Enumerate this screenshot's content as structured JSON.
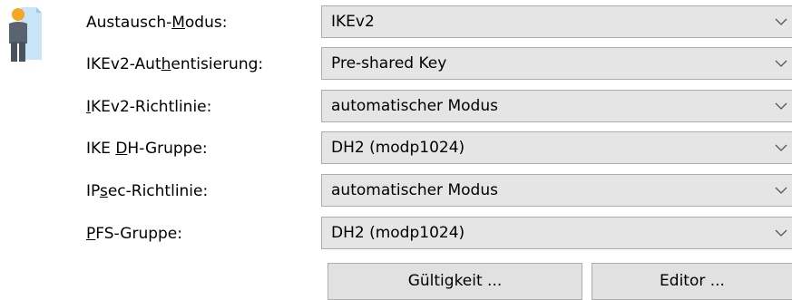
{
  "rows": [
    {
      "label_pre": "Austausch-",
      "label_key": "M",
      "label_post": "odus:",
      "value": "IKEv2"
    },
    {
      "label_pre": "IKEv2-Aut",
      "label_key": "h",
      "label_post": "entisierung:",
      "value": "Pre-shared Key"
    },
    {
      "label_pre": "",
      "label_key": "I",
      "label_post": "KEv2-Richtlinie:",
      "value": "automatischer Modus"
    },
    {
      "label_pre": "IKE ",
      "label_key": "D",
      "label_post": "H-Gruppe:",
      "value": "DH2 (modp1024)"
    },
    {
      "label_pre": "IP",
      "label_key": "s",
      "label_post": "ec-Richtlinie:",
      "value": "automatischer Modus"
    },
    {
      "label_pre": "",
      "label_key": "P",
      "label_post": "FS-Gruppe:",
      "value": "DH2 (modp1024)"
    }
  ],
  "buttons": {
    "validity": "Gültigkeit ...",
    "editor": "Editor ..."
  },
  "icons": {
    "user": "user-document-icon",
    "dropdown": "chevron-down-icon"
  },
  "colors": {
    "combo_bg": "#e5e5e5",
    "button_bg": "#e1e1e1",
    "border": "#adadad",
    "icon_doc": "#c9e6f9",
    "icon_person": "#5a6470",
    "icon_head": "#f5a623"
  }
}
